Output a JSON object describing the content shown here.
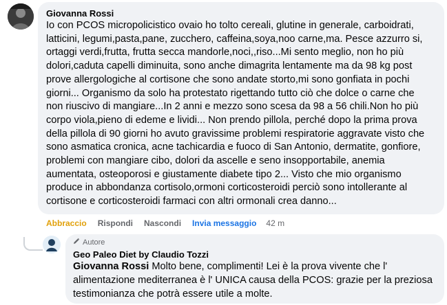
{
  "comment": {
    "author": "Giovanna Rossi",
    "text": "Io con PCOS micropolicistico ovaio ho tolto cereali, glutine in generale, carboidrati,\nlatticini, legumi,pasta,pane, zucchero, caffeina,soya,noo carne,ma. Pesce azzurro si,\nortaggi verdi,frutta, frutta secca mandorle,noci,,riso...Mi sento meglio, non ho più\ndolori,caduta capelli diminuita, sono anche dimagrita lentamente ma da 98 kg post\nprove allergologiche al cortisone che sono andate storto,mi sono gonfiata in pochi\ngiorni... Organismo da solo ha protestato rigettando tutto ciò che dolce o carne che\nnon riuscivo di mangiare...In 2 anni e mezzo sono scesa da 98 a 56 chili.Non ho più\ncorpo viola,pieno di edeme e lividi... Non prendo pillola, perché dopo la prima prova\ndella pillola di 90 giorni ho avuto gravissime problemi respiratorie aggravate visto che\nsono asmatica cronica, acne tachicardia e fuoco di San Antonio, dermatite, gonfiore,\nproblemi con mangiare cibo, dolori da ascelle e seno insopportabile, anemia\naumentata, osteoporosi e giustamente diabete tipo 2... Visto che mio organismo\nproduce in abbondanza cortisolo,ormoni corticosteroidi perciò sono intollerante al\ncortisone e corticosteroidi farmaci con altri ormonali crea danno..."
  },
  "actions": {
    "like": "Abbraccio",
    "reply": "Rispondi",
    "hide": "Nascondi",
    "send": "Invia messaggio",
    "time": "42 m"
  },
  "reply": {
    "badge": "Autore",
    "author": "Geo Paleo Diet by Claudio Tozzi",
    "mention": "Giovanna Rossi",
    "text": " Molto bene, complimenti! Lei è la prova vivente che l'\nalimentazione mediterranea è l' UNICA causa della PCOS: grazie per la preziosa\ntestimonianza che potrà essere utile a molte."
  },
  "icons": {
    "badge_icon": "pencil-icon",
    "avatar_main": "profile-photo",
    "avatar_reply": "page-logo"
  },
  "colors": {
    "bubble": "#f0f2f5",
    "like": "#e1a00a",
    "link": "#1b74e4",
    "muted": "#65676b"
  }
}
